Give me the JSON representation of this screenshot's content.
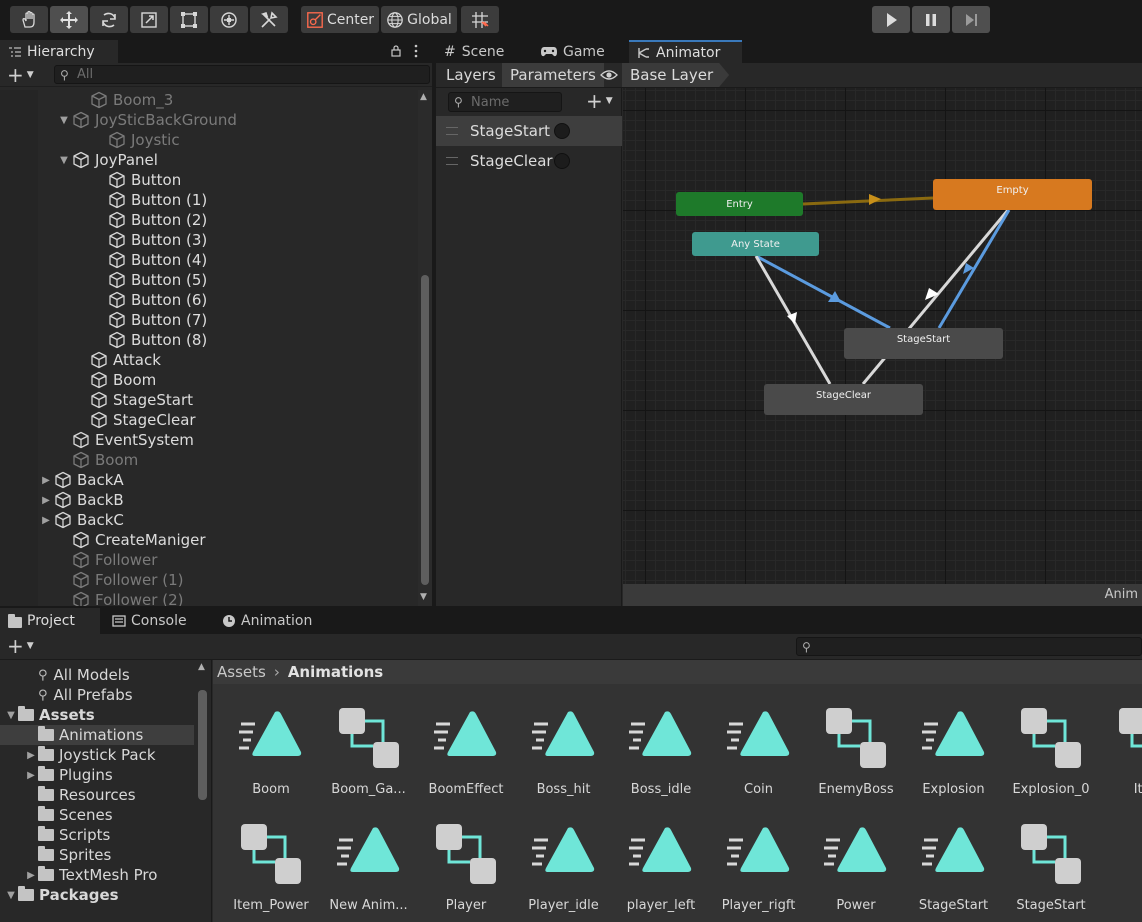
{
  "toolbar": {
    "pivot_label": "Center",
    "space_label": "Global"
  },
  "hierarchy": {
    "tab_label": "Hierarchy",
    "search_placeholder": "All",
    "items": [
      {
        "label": "Boom_3",
        "dim": true
      },
      {
        "label": "JoySticBackGround",
        "dim": true,
        "expanded": true
      },
      {
        "label": "Joystic",
        "dim": true
      },
      {
        "label": "JoyPanel",
        "dim": false,
        "expanded": true
      },
      {
        "label": "Button"
      },
      {
        "label": "Button (1)"
      },
      {
        "label": "Button (2)"
      },
      {
        "label": "Button (3)"
      },
      {
        "label": "Button (4)"
      },
      {
        "label": "Button (5)"
      },
      {
        "label": "Button (6)"
      },
      {
        "label": "Button (7)"
      },
      {
        "label": "Button (8)"
      },
      {
        "label": "Attack"
      },
      {
        "label": "Boom"
      },
      {
        "label": "StageStart"
      },
      {
        "label": "StageClear"
      },
      {
        "label": "EventSystem"
      },
      {
        "label": "Boom",
        "dim": true
      },
      {
        "label": "BackA",
        "collapsed": true
      },
      {
        "label": "BackB",
        "collapsed": true
      },
      {
        "label": "BackC",
        "collapsed": true
      },
      {
        "label": "CreateManiger"
      },
      {
        "label": "Follower",
        "dim": true
      },
      {
        "label": "Follower (1)",
        "dim": true
      },
      {
        "label": "Follower (2)",
        "dim": true
      }
    ]
  },
  "animator": {
    "tabs": [
      "Scene",
      "Game",
      "Animator"
    ],
    "active_tab": "Animator",
    "subtabs": [
      "Layers",
      "Parameters"
    ],
    "breadcrumb": "Base Layer",
    "param_search_placeholder": "Name",
    "parameters": [
      {
        "name": "StageStart",
        "type": "trigger"
      },
      {
        "name": "StageClear",
        "type": "trigger"
      }
    ],
    "states": {
      "entry": "Entry",
      "any_state": "Any State",
      "empty": "Empty",
      "stage_start": "StageStart",
      "stage_clear": "StageClear"
    },
    "status_text": "Anim",
    "colors": {
      "entry": "#1e7a2a",
      "any_state": "#3f9a8f",
      "default_state": "#d7791f",
      "state": "#4a4a4a",
      "selected_transition": "#5b9bdf",
      "transition": "#d8d8d8",
      "entry_transition": "#8a6a10"
    }
  },
  "project": {
    "tabs": [
      "Project",
      "Console",
      "Animation"
    ],
    "tree": [
      {
        "label": "All Models",
        "type": "search"
      },
      {
        "label": "All Prefabs",
        "type": "search"
      },
      {
        "label": "Assets",
        "type": "root",
        "expanded": true
      },
      {
        "label": "Animations",
        "type": "folder",
        "selected": true
      },
      {
        "label": "Joystick Pack",
        "type": "folder",
        "collapsed": true
      },
      {
        "label": "Plugins",
        "type": "folder",
        "collapsed": true
      },
      {
        "label": "Resources",
        "type": "folder"
      },
      {
        "label": "Scenes",
        "type": "folder"
      },
      {
        "label": "Scripts",
        "type": "folder"
      },
      {
        "label": "Sprites",
        "type": "folder"
      },
      {
        "label": "TextMesh Pro",
        "type": "folder",
        "collapsed": true
      },
      {
        "label": "Packages",
        "type": "root",
        "expanded": true
      }
    ],
    "breadcrumb_root": "Assets",
    "breadcrumb_current": "Animations",
    "assets_row1": [
      {
        "label": "Boom",
        "kind": "clip"
      },
      {
        "label": "Boom_Ga...",
        "kind": "controller"
      },
      {
        "label": "BoomEffect",
        "kind": "clip"
      },
      {
        "label": "Boss_hit",
        "kind": "clip"
      },
      {
        "label": "Boss_idle",
        "kind": "clip"
      },
      {
        "label": "Coin",
        "kind": "clip"
      },
      {
        "label": "EnemyBoss",
        "kind": "controller"
      },
      {
        "label": "Explosion",
        "kind": "clip"
      },
      {
        "label": "Explosion_0",
        "kind": "controller"
      },
      {
        "label": "Item",
        "kind": "controller"
      }
    ],
    "assets_row2": [
      {
        "label": "Item_Power",
        "kind": "controller"
      },
      {
        "label": "New Anim...",
        "kind": "clip"
      },
      {
        "label": "Player",
        "kind": "controller"
      },
      {
        "label": "Player_idle",
        "kind": "clip"
      },
      {
        "label": "player_left",
        "kind": "clip"
      },
      {
        "label": "Player_rigft",
        "kind": "clip"
      },
      {
        "label": "Power",
        "kind": "clip"
      },
      {
        "label": "StageStart",
        "kind": "clip"
      },
      {
        "label": "StageStart",
        "kind": "controller"
      }
    ],
    "clip_color": "#6fe6d8"
  }
}
